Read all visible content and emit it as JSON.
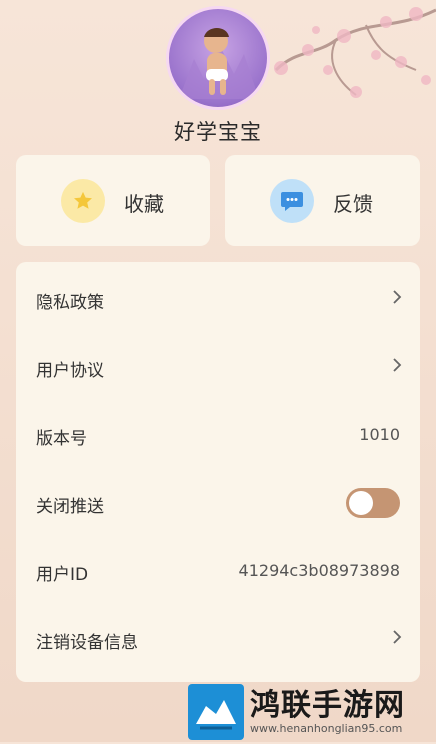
{
  "profile": {
    "username": "好学宝宝"
  },
  "quick_actions": {
    "favorites": {
      "label": "收藏",
      "icon": "star-icon",
      "color": "#f4c73a"
    },
    "feedback": {
      "label": "反馈",
      "icon": "chat-bubble-icon",
      "color": "#3b8fe0"
    }
  },
  "settings": {
    "privacy_policy": {
      "label": "隐私政策"
    },
    "user_agreement": {
      "label": "用户协议"
    },
    "version": {
      "label": "版本号",
      "value": "1010"
    },
    "push": {
      "label": "关闭推送",
      "enabled": false
    },
    "user_id": {
      "label": "用户ID",
      "value": "41294c3b08973898"
    },
    "deregister_device": {
      "label": "注销设备信息"
    }
  },
  "watermark": {
    "title": "鸿联手游网",
    "url": "www.henanhonglian95.com"
  },
  "colors": {
    "toggle_track": "#c59573",
    "card_bg": "#fbf5ea"
  }
}
